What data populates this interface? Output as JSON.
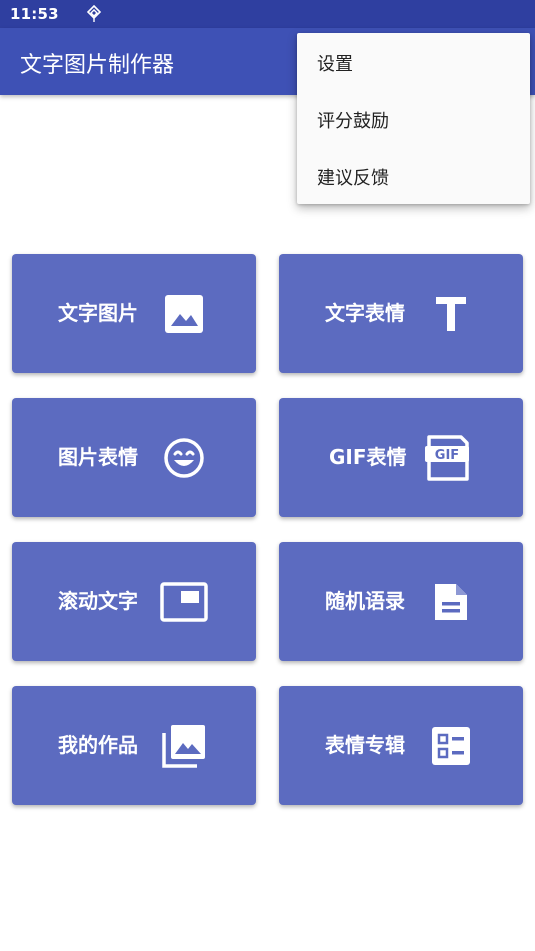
{
  "status_bar": {
    "time": "11:53"
  },
  "app_bar": {
    "title": "文字图片制作器"
  },
  "popup_menu": {
    "items": [
      {
        "label": "设置"
      },
      {
        "label": "评分鼓励"
      },
      {
        "label": "建议反馈"
      }
    ]
  },
  "tiles": [
    {
      "label": "文字图片",
      "icon": "image-icon"
    },
    {
      "label": "文字表情",
      "icon": "text-t-icon"
    },
    {
      "label": "图片表情",
      "icon": "smiley-icon"
    },
    {
      "label": "GIF表情",
      "icon": "gif-icon"
    },
    {
      "label": "滚动文字",
      "icon": "picture-in-picture-icon"
    },
    {
      "label": "随机语录",
      "icon": "document-icon"
    },
    {
      "label": "我的作品",
      "icon": "photo-library-icon"
    },
    {
      "label": "表情专辑",
      "icon": "checklist-icon"
    }
  ],
  "colors": {
    "status_bar": "#2f3fa0",
    "app_bar": "#3e51b5",
    "tile": "#5c6bc0",
    "menu_bg": "#fafafa"
  }
}
